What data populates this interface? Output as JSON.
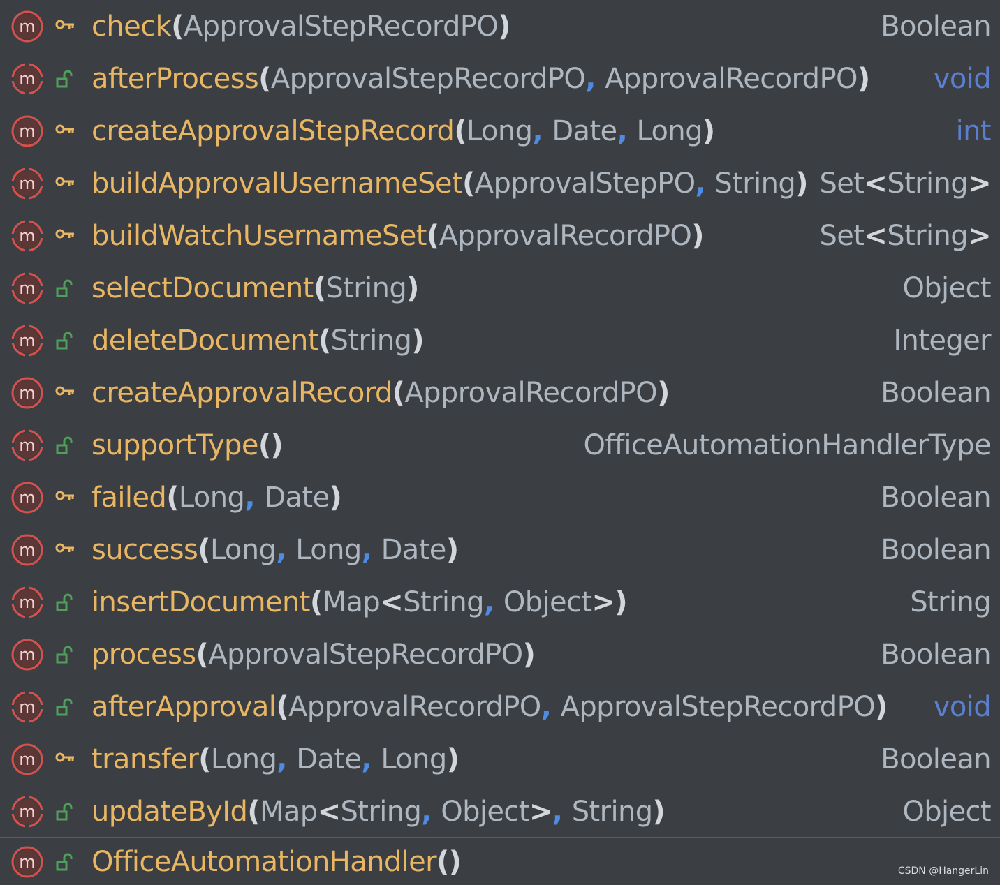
{
  "methods": [
    {
      "name": "check",
      "params": [
        "ApprovalStepRecordPO"
      ],
      "returns": "Boolean",
      "visibility": "private",
      "overridden": false
    },
    {
      "name": "afterProcess",
      "params": [
        "ApprovalStepRecordPO",
        "ApprovalRecordPO"
      ],
      "returns": "void",
      "visibility": "public",
      "overridden": true
    },
    {
      "name": "createApprovalStepRecord",
      "params": [
        "Long",
        "Date",
        "Long"
      ],
      "returns": "int",
      "visibility": "private",
      "overridden": false
    },
    {
      "name": "buildApprovalUsernameSet",
      "params": [
        "ApprovalStepPO",
        "String"
      ],
      "returns": "Set<String>",
      "visibility": "private",
      "overridden": true
    },
    {
      "name": "buildWatchUsernameSet",
      "params": [
        "ApprovalRecordPO"
      ],
      "returns": "Set<String>",
      "visibility": "private",
      "overridden": true
    },
    {
      "name": "selectDocument",
      "params": [
        "String"
      ],
      "returns": "Object",
      "visibility": "public",
      "overridden": true
    },
    {
      "name": "deleteDocument",
      "params": [
        "String"
      ],
      "returns": "Integer",
      "visibility": "public",
      "overridden": true
    },
    {
      "name": "createApprovalRecord",
      "params": [
        "ApprovalRecordPO"
      ],
      "returns": "Boolean",
      "visibility": "private",
      "overridden": false
    },
    {
      "name": "supportType",
      "params": [],
      "returns": "OfficeAutomationHandlerType",
      "visibility": "public",
      "overridden": true
    },
    {
      "name": "failed",
      "params": [
        "Long",
        "Date"
      ],
      "returns": "Boolean",
      "visibility": "private",
      "overridden": false
    },
    {
      "name": "success",
      "params": [
        "Long",
        "Long",
        "Date"
      ],
      "returns": "Boolean",
      "visibility": "private",
      "overridden": false
    },
    {
      "name": "insertDocument",
      "params": [
        "Map<String, Object>"
      ],
      "returns": "String",
      "visibility": "public",
      "overridden": true
    },
    {
      "name": "process",
      "params": [
        "ApprovalStepRecordPO"
      ],
      "returns": "Boolean",
      "visibility": "public",
      "overridden": false
    },
    {
      "name": "afterApproval",
      "params": [
        "ApprovalRecordPO",
        "ApprovalStepRecordPO"
      ],
      "returns": "void",
      "visibility": "public",
      "overridden": true
    },
    {
      "name": "transfer",
      "params": [
        "Long",
        "Date",
        "Long"
      ],
      "returns": "Boolean",
      "visibility": "private",
      "overridden": false
    },
    {
      "name": "updateById",
      "params": [
        "Map<String, Object>",
        "String"
      ],
      "returns": "Object",
      "visibility": "public",
      "overridden": true
    }
  ],
  "constructor": {
    "name": "OfficeAutomationHandler",
    "params": [],
    "visibility": "public",
    "overridden": false
  },
  "keyword_returns": [
    "void",
    "int"
  ],
  "watermark": "CSDN @HangerLin",
  "colors": {
    "background": "#3b3e42",
    "method_name": "#e9b663",
    "param_type": "#aeb6bf",
    "comma": "#4f8be0",
    "keyword": "#5b7fd0",
    "method_icon": "#d9504b",
    "private_icon": "#e9b663",
    "public_icon": "#4fa05a"
  }
}
